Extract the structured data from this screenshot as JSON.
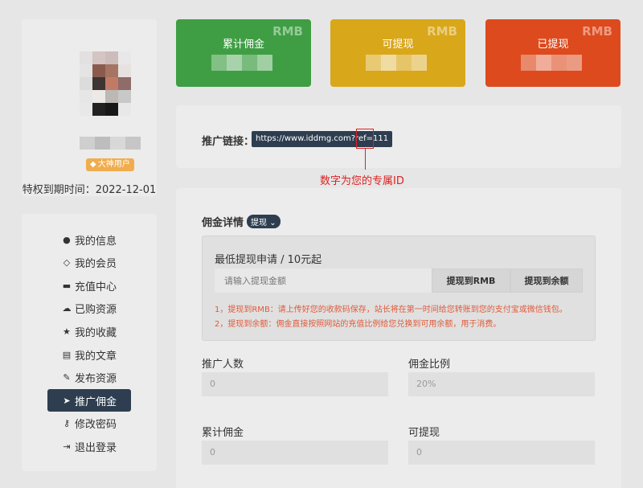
{
  "profile": {
    "vip_badge": "大神用户",
    "expire_text": "特权到期时间：2022-12-01",
    "avatar_pixels": [
      "#e2e0e0",
      "#d4c4c2",
      "#cdbcbc",
      "#e8e8e8",
      "#e4e4e4",
      "#8a5b4d",
      "#a57463",
      "#e6e2e0",
      "#dcdcdc",
      "#3d3533",
      "#c27a66",
      "#8f6c68",
      "#e6e6e6",
      "#ede9e7",
      "#bcb8b6",
      "#c8c8c8",
      "#e8e8e8",
      "#222222",
      "#181818",
      "#e8e8e8"
    ]
  },
  "nav": [
    {
      "icon": "user-icon",
      "glyph": "●",
      "label": "我的信息"
    },
    {
      "icon": "diamond-icon",
      "glyph": "◇",
      "label": "我的会员"
    },
    {
      "icon": "credit-card-icon",
      "glyph": "▬",
      "label": "充值中心"
    },
    {
      "icon": "cloud-download-icon",
      "glyph": "☁",
      "label": "已购资源"
    },
    {
      "icon": "star-icon",
      "glyph": "★",
      "label": "我的收藏"
    },
    {
      "icon": "file-icon",
      "glyph": "▤",
      "label": "我的文章"
    },
    {
      "icon": "pencil-icon",
      "glyph": "✎",
      "label": "发布资源"
    },
    {
      "icon": "paper-plane-icon",
      "glyph": "➤",
      "label": "推广佣金",
      "active": true
    },
    {
      "icon": "key-icon",
      "glyph": "⚷",
      "label": "修改密码"
    },
    {
      "icon": "sign-out-icon",
      "glyph": "⇥",
      "label": "退出登录"
    }
  ],
  "stats": [
    {
      "label": "累计佣金",
      "currency": "RMB",
      "color": "#3f9e44"
    },
    {
      "label": "可提现",
      "currency": "RMB",
      "color": "#d9a71a"
    },
    {
      "label": "已提现",
      "currency": "RMB",
      "color": "#dd4a1e"
    }
  ],
  "referral": {
    "label": "推广链接：",
    "link": "https://www.iddmg.com?ref=111",
    "note": "数字为您的专属ID"
  },
  "detail": {
    "title": "佣金详情",
    "tag": "提现",
    "withdraw_title": "最低提现申请 / 10元起",
    "amount_placeholder": "请输入提现金额",
    "btn_rmb": "提现到RMB",
    "btn_balance": "提现到余额",
    "note1": "1，提现到RMB：请上传好您的收款码保存，站长将在第一时间给您转账到您的支付宝或微信钱包。",
    "note2": "2，提现到余额：佣金直接按照网站的充值比例给您兑换到可用余额，用于消费。",
    "fields": {
      "promo_count_label": "推广人数",
      "promo_count_value": "0",
      "ratio_label": "佣金比例",
      "ratio_value": "20%",
      "total_label": "累计佣金",
      "total_value": "0",
      "withdrawable_label": "可提现",
      "withdrawable_value": "0"
    }
  }
}
